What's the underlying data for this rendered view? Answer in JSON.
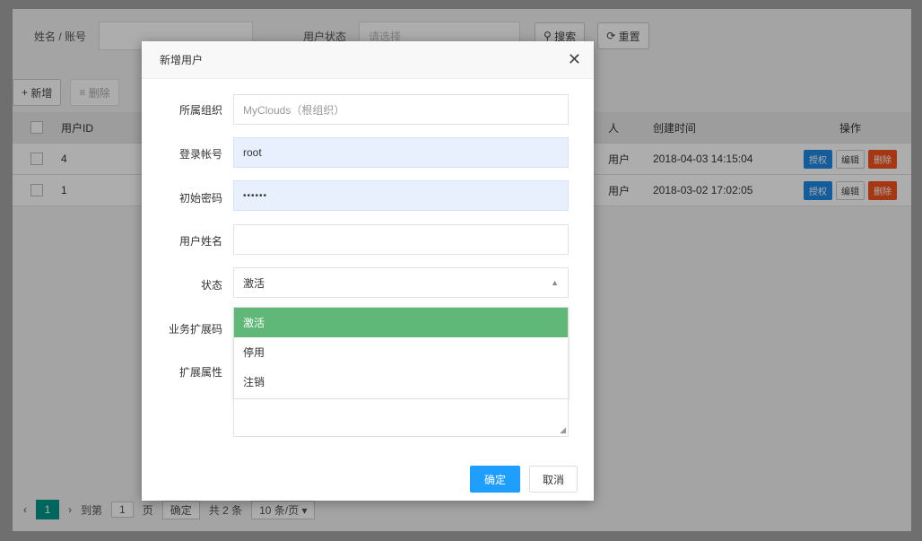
{
  "filter": {
    "name_label": "姓名 / 账号",
    "name_value": "",
    "status_label": "用户状态",
    "status_placeholder": "请选择",
    "search_label": "搜索",
    "reset_label": "重置"
  },
  "toolbar": {
    "add_label": "新增",
    "delete_label": "删除"
  },
  "table": {
    "headers": [
      "用户ID",
      "",
      "人",
      "创建时间",
      "操作"
    ],
    "rows": [
      {
        "id": "4",
        "c2": "",
        "type": "用户",
        "created": "2018-04-03 14:15:04"
      },
      {
        "id": "1",
        "c2": "",
        "type": "用户",
        "created": "2018-03-02 17:02:05"
      }
    ],
    "actions": {
      "grant": "授权",
      "edit": "编辑",
      "del": "删除"
    }
  },
  "pager": {
    "current": "1",
    "goto_label": "到第",
    "goto_value": "1",
    "page_unit": "页",
    "confirm_label": "确定",
    "total": "共 2 条",
    "page_size": "10 条/页"
  },
  "modal": {
    "title": "新增用户",
    "fields": {
      "org": {
        "label": "所属组织",
        "value": "MyClouds（根组织）"
      },
      "account": {
        "label": "登录帐号",
        "value": "root"
      },
      "password": {
        "label": "初始密码",
        "value": "••••••"
      },
      "name": {
        "label": "用户姓名",
        "value": ""
      },
      "status": {
        "label": "状态",
        "value": "激活"
      },
      "bizcode": {
        "label": "业务扩展码"
      },
      "ext": {
        "label": "扩展属性"
      }
    },
    "status_options": [
      "激活",
      "停用",
      "注销"
    ],
    "ok_label": "确定",
    "cancel_label": "取消"
  },
  "colors": {
    "primary": "#1e9fff",
    "selected_option": "#5fb878",
    "pager_current": "#009688",
    "danger": "#f4511e"
  }
}
